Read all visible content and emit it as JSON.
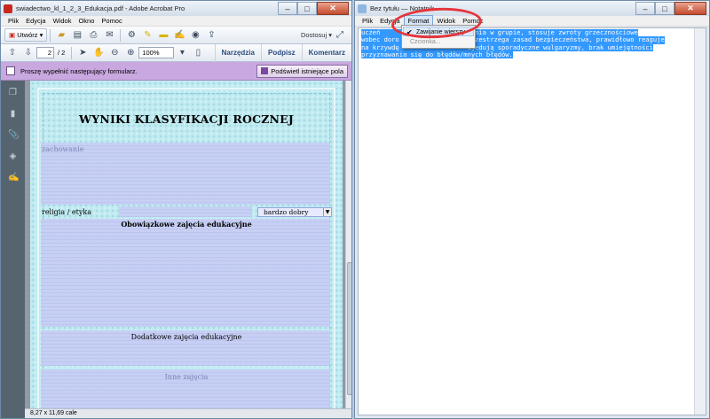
{
  "acrobat": {
    "title": "swiadectwo_kl_1_2_3_Edukacja.pdf - Adobe Acrobat Pro",
    "menu": [
      "Plik",
      "Edycja",
      "Widok",
      "Okno",
      "Pomoc"
    ],
    "create_label": "Utwórz",
    "customize_label": "Dostosuj",
    "page_current": "2",
    "page_total": "/ 2",
    "zoom": "100%",
    "panel_links": [
      "Narzędzia",
      "Podpisz",
      "Komentarz"
    ],
    "form_message": "Proszę wypełnić następujący formularz.",
    "highlight_label": "Podświetl istniejące pola",
    "doc": {
      "title": "WYNIKI KLASYFIKACJI ROCZNEJ",
      "behavior_label": "zachowanie",
      "religion_label": "religia / etyka",
      "religion_value": "bardzo dobry",
      "mandatory_label": "Obowiązkowe zajęcia edukacyjne",
      "additional_label": "Dodatkowe zajęcia edukacyjne",
      "other_label": "Inne zajęcia"
    },
    "status": "8,27 x 11,69 cale"
  },
  "notepad": {
    "title": "Bez tytułu — Notatnik",
    "menu": [
      "Plik",
      "Edycja",
      "Format",
      "Widok",
      "Pomoc"
    ],
    "text_lines": [
      "uczeń              funkcjonowania w grupie, stosuje zwroty grzecznościowe",
      "wobec doro                  przestrzega zasad bezpieczeństwa, prawidłowo reaguje",
      "na krzywdę                  ujedują sporadyczne wulgaryzmy, brak umiejętności",
      "przyznawania się do błędów/mnych błędów."
    ],
    "format_menu": {
      "word_wrap": "Zawijanie wierszy",
      "font": "Czcionka..."
    }
  },
  "colors": {
    "selection": "#3399ff",
    "form_bar": "#c9a8e0",
    "annotation": "#e5353b"
  }
}
